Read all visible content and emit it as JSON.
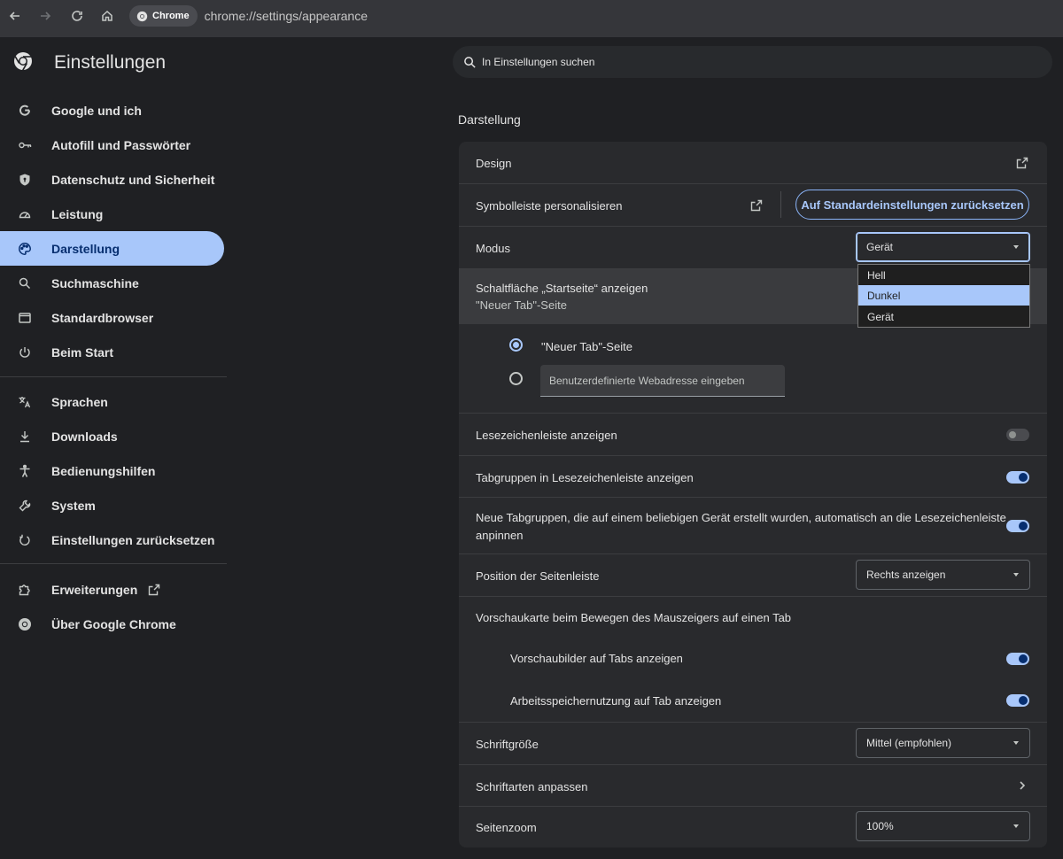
{
  "browser": {
    "chip_label": "Chrome",
    "url": "chrome://settings/appearance"
  },
  "sidebar": {
    "title": "Einstellungen",
    "items": [
      {
        "label": "Google und ich",
        "icon": "google-icon"
      },
      {
        "label": "Autofill und Passwörter",
        "icon": "key-icon"
      },
      {
        "label": "Datenschutz und Sicherheit",
        "icon": "shield-icon"
      },
      {
        "label": "Leistung",
        "icon": "speedometer-icon"
      },
      {
        "label": "Darstellung",
        "icon": "palette-icon",
        "active": true
      },
      {
        "label": "Suchmaschine",
        "icon": "search-icon"
      },
      {
        "label": "Standardbrowser",
        "icon": "browser-window-icon"
      },
      {
        "label": "Beim Start",
        "icon": "power-icon"
      },
      {
        "label": "Sprachen",
        "icon": "translate-icon"
      },
      {
        "label": "Downloads",
        "icon": "download-icon"
      },
      {
        "label": "Bedienungshilfen",
        "icon": "accessibility-icon"
      },
      {
        "label": "System",
        "icon": "wrench-icon"
      },
      {
        "label": "Einstellungen zurücksetzen",
        "icon": "reset-icon"
      },
      {
        "label": "Erweiterungen",
        "icon": "puzzle-icon"
      },
      {
        "label": "Über Google Chrome",
        "icon": "chrome-logo-icon"
      }
    ]
  },
  "search": {
    "placeholder": "In Einstellungen suchen"
  },
  "section_title": "Darstellung",
  "settings": {
    "design": "Design",
    "toolbar": "Symbolleiste personalisieren",
    "reset_button": "Auf Standardeinstellungen zurücksetzen",
    "mode": {
      "label": "Modus",
      "value": "Gerät",
      "options": [
        "Hell",
        "Dunkel",
        "Gerät"
      ],
      "highlighted": "Dunkel"
    },
    "home_button": {
      "label": "Schaltfläche „Startseite“ anzeigen",
      "sub": "\"Neuer Tab\"-Seite"
    },
    "radio_newtab": "\"Neuer Tab\"-Seite",
    "custom_url_placeholder": "Benutzerdefinierte Webadresse eingeben",
    "bookmarks_bar": {
      "label": "Lesezeichenleiste anzeigen",
      "on": false
    },
    "tab_groups": {
      "label": "Tabgruppen in Lesezeichenleiste anzeigen",
      "on": true
    },
    "auto_pin": {
      "label_line1": "Neue Tabgruppen, die auf einem beliebigen Gerät erstellt wurden, automatisch an die Lesezeichenleiste",
      "label_line2": "anpinnen",
      "on": true
    },
    "sidepanel": {
      "label": "Position der Seitenleiste",
      "value": "Rechts anzeigen"
    },
    "hover_card": "Vorschaukarte beim Bewegen des Mauszeigers auf einen Tab",
    "hover_images": {
      "label": "Vorschaubilder auf Tabs anzeigen",
      "on": true
    },
    "hover_memory": {
      "label": "Arbeitsspeichernutzung auf Tab anzeigen",
      "on": true
    },
    "font_size": {
      "label": "Schriftgröße",
      "value": "Mittel (empfohlen)"
    },
    "custom_fonts": "Schriftarten anpassen",
    "page_zoom": {
      "label": "Seitenzoom",
      "value": "100%"
    }
  },
  "colors": {
    "accent": "#a8c7fa",
    "background": "#1f2023",
    "card": "#292a2d"
  }
}
